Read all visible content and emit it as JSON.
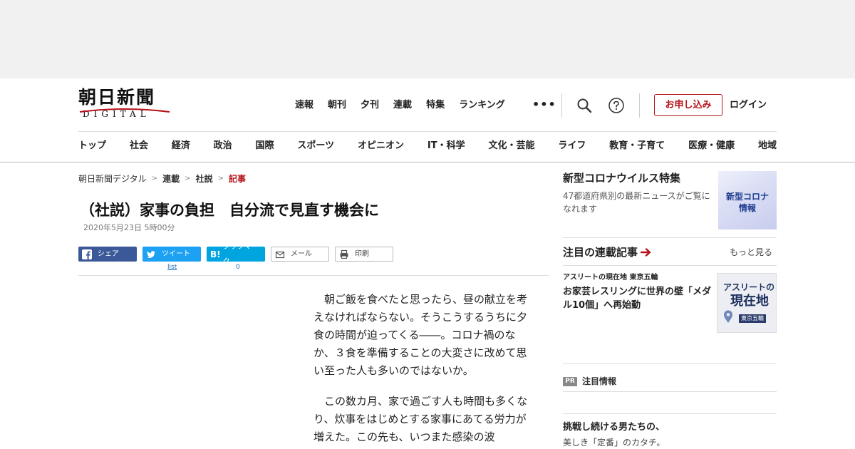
{
  "brand": {
    "name": "朝日新聞",
    "subtitle": "DIGITAL"
  },
  "top_nav": [
    "速報",
    "朝刊",
    "夕刊",
    "連載",
    "特集",
    "ランキング"
  ],
  "more_label": "•••",
  "header_actions": {
    "apply_label": "お申し込み",
    "login_label": "ログイン"
  },
  "category_nav": [
    "トップ",
    "社会",
    "経済",
    "政治",
    "国際",
    "スポーツ",
    "オピニオン",
    "IT・科学",
    "文化・芸能",
    "ライフ",
    "教育・子育て",
    "医療・健康",
    "地域"
  ],
  "breadcrumb": [
    "朝日新聞デジタル",
    "連載",
    "社説",
    "記事"
  ],
  "breadcrumb_sep": ">",
  "article": {
    "title": "（社説）家事の負担　自分流で見直す機会に",
    "date": "2020年5月23日 5時00分",
    "paragraphs": [
      "朝ご飯を食べたと思ったら、昼の献立を考えなければならない。そうこうするうちに夕食の時間が迫ってくる――。コロナ禍のなか、３食を準備することの大変さに改めて思い至った人も多いのではないか。",
      "この数カ月、家で過ごす人も時間も多くなり、炊事をはじめとする家事にあてる労力が増えた。この先も、いつまた感染の波"
    ]
  },
  "share": {
    "facebook_label": "シェア",
    "twitter_label": "ツイート",
    "twitter_count": "list",
    "hatena_label": "ブックマーク",
    "hatena_count": "0",
    "mail_label": "メール",
    "print_label": "印刷"
  },
  "sidebar": {
    "corona": {
      "title": "新型コロナウイルス特集",
      "desc": "47都道府県別の最新ニュースがご覧になれます",
      "image_line1": "新型コロナ",
      "image_line2": "情報"
    },
    "serials": {
      "title": "注目の連載記事",
      "more_label": "もっと見る",
      "category": "アスリートの現在地 東京五輪",
      "headline": "お家芸レスリングに世界の壁「メダル10個」へ再始動",
      "image_line1": "アスリートの",
      "image_line2": "現在地",
      "image_line3": "東京五輪"
    },
    "pr": {
      "badge": "PR",
      "label": "注目情報"
    },
    "promo": {
      "title": "挑戦し続ける男たちの、",
      "desc": "美しき「定番」のカタチ。"
    }
  },
  "colors": {
    "brand_red": "#b5121b",
    "facebook": "#3b5998",
    "twitter": "#1da1f2",
    "hatena": "#00a4de"
  }
}
